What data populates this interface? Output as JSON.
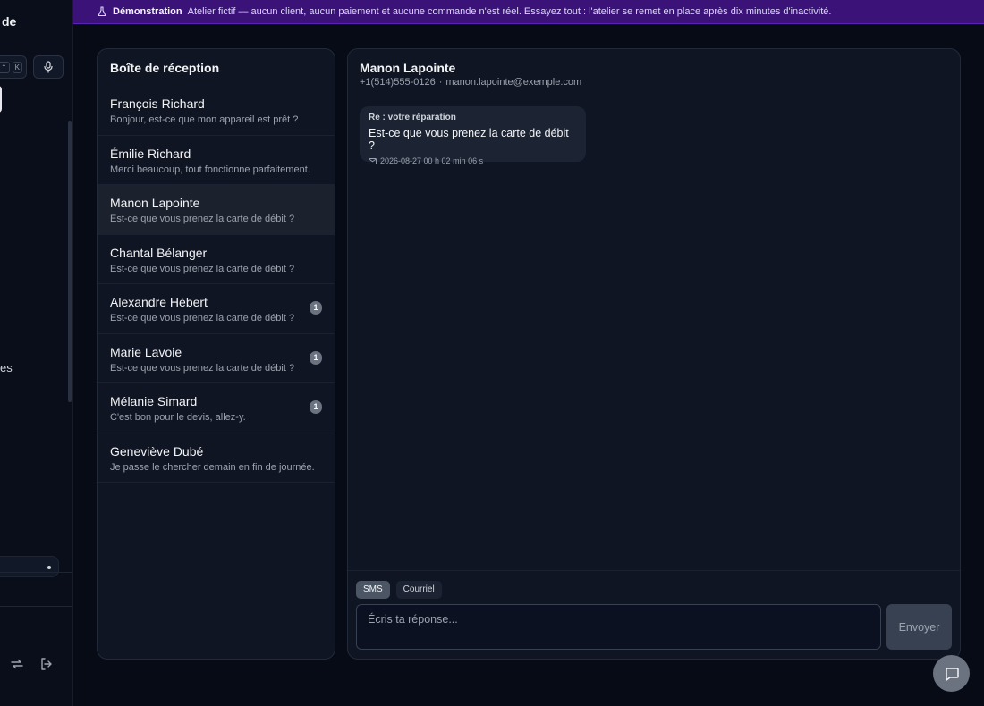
{
  "sidebar": {
    "brand_fragment": "de",
    "kbd_keys": [
      "⌃",
      "K"
    ],
    "partial_label": "es"
  },
  "banner": {
    "label": "Démonstration",
    "message": "Atelier fictif — aucun client, aucun paiement et aucune commande n'est réel. Essayez tout : l'atelier se remet en place après dix minutes d'inactivité."
  },
  "inbox": {
    "title": "Boîte de réception",
    "conversations": [
      {
        "name": "François Richard",
        "preview": "Bonjour, est-ce que mon appareil est prêt ?",
        "unread": null
      },
      {
        "name": "Émilie Richard",
        "preview": "Merci beaucoup, tout fonctionne parfaitement.",
        "unread": null
      },
      {
        "name": "Manon Lapointe",
        "preview": "Est-ce que vous prenez la carte de débit ?",
        "unread": null,
        "selected": true
      },
      {
        "name": "Chantal Bélanger",
        "preview": "Est-ce que vous prenez la carte de débit ?",
        "unread": null
      },
      {
        "name": "Alexandre Hébert",
        "preview": "Est-ce que vous prenez la carte de débit ?",
        "unread": "1"
      },
      {
        "name": "Marie Lavoie",
        "preview": "Est-ce que vous prenez la carte de débit ?",
        "unread": "1"
      },
      {
        "name": "Mélanie Simard",
        "preview": "C'est bon pour le devis, allez-y.",
        "unread": "1"
      },
      {
        "name": "Geneviève Dubé",
        "preview": "Je passe le chercher demain en fin de journée.",
        "unread": null
      }
    ]
  },
  "thread": {
    "name": "Manon Lapointe",
    "phone": "+1(514)555-0126",
    "separator": "·",
    "email": "manon.lapointe@exemple.com",
    "message": {
      "subject": "Re : votre réparation",
      "body": "Est-ce que vous prenez la carte de débit ?",
      "timestamp": "2026-08-27 00 h 02 min 06 s",
      "channel_icon": "mail-icon"
    },
    "channels": [
      "SMS",
      "Courriel"
    ],
    "active_channel": "SMS",
    "reply_placeholder": "Écris ta réponse...",
    "send_label": "Envoyer"
  },
  "colors": {
    "background": "#070b16",
    "panel": "#0f1522",
    "banner": "#3b1278",
    "selected_row": "#1c222d",
    "badge": "#6b7280"
  }
}
